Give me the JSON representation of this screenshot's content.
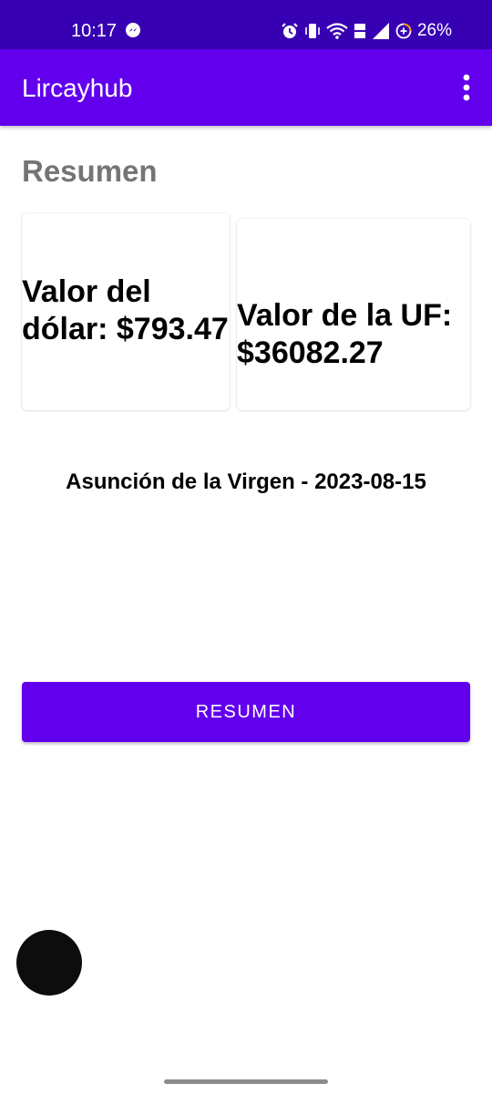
{
  "status_bar": {
    "time": "10:17",
    "battery_percent": "26%",
    "background_color": "#3700b3",
    "icons": [
      "messenger-icon",
      "alarm-icon",
      "vibrate-icon",
      "wifi-icon",
      "volte-icon",
      "cell-signal-icon",
      "battery-saver-icon"
    ]
  },
  "toolbar": {
    "title": "Lircayhub",
    "background_color": "#6200ee",
    "overflow_icon": "more-vert-icon"
  },
  "main": {
    "section_title": "Resumen",
    "cards": [
      {
        "text": "Valor del dólar: $793.47"
      },
      {
        "text": "Valor de la UF: $36082.27"
      }
    ],
    "holiday_text": "Asunción de la Virgen - 2023-08-15",
    "button_label": "RESUMEN"
  },
  "accent_color": "#6200ee"
}
